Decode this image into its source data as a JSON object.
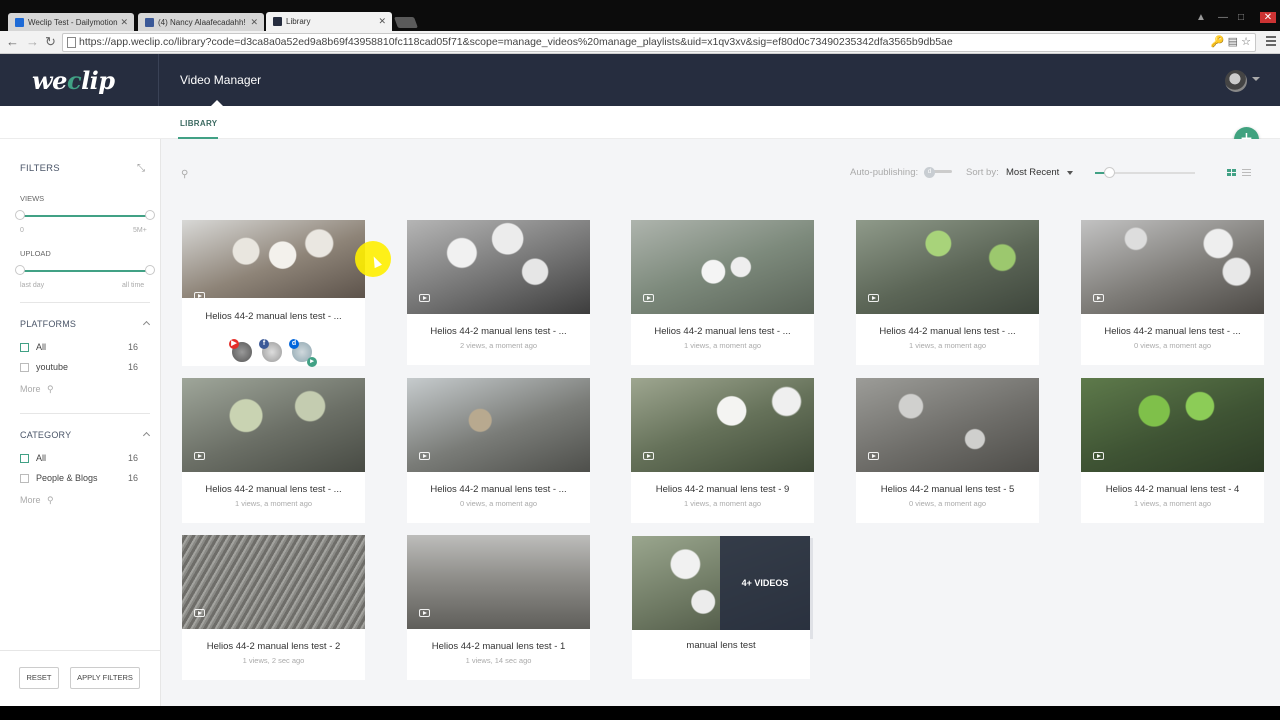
{
  "browser": {
    "tabs": [
      {
        "label": "Weclip Test - Dailymotion",
        "icon": "dailymotion-icon"
      },
      {
        "label": "(4) Nancy Alaafecadahh!",
        "icon": "facebook-icon"
      },
      {
        "label": "Library",
        "icon": "weclip-icon"
      }
    ],
    "url": "https://app.weclip.co/library?code=d3ca8a0a52ed9a8b69f43958810fc118cad05f71&scope=manage_videos%20manage_playlists&uid=x1qv3xv&sig=ef80d0c73490235342dfa3565b9db5ae"
  },
  "header": {
    "logo": {
      "pre": "we",
      "mid": "c",
      "post": "lip"
    },
    "title": "Video Manager"
  },
  "subnav": {
    "tab": "LIBRARY"
  },
  "sidebar": {
    "title": "FILTERS",
    "views_label": "VIEWS",
    "views_min": "0",
    "views_max": "5M+",
    "upload_label": "UPLOAD",
    "upload_min": "last day",
    "upload_max": "all time",
    "platforms_title": "PLATFORMS",
    "platforms": [
      {
        "label": "All",
        "count": "16"
      },
      {
        "label": "youtube",
        "count": "16"
      }
    ],
    "more": "More",
    "category_title": "CATEGORY",
    "categories": [
      {
        "label": "All",
        "count": "16"
      },
      {
        "label": "People & Blogs",
        "count": "16"
      }
    ],
    "reset": "RESET",
    "apply": "APPLY FILTERS"
  },
  "toolbar": {
    "autopub_label": "Auto-publishing:",
    "sort_label": "Sort by:",
    "sort_value": "Most Recent"
  },
  "colors": {
    "accent": "#41a185",
    "header_bg": "#262d3f"
  },
  "videos": [
    {
      "title": "Helios 44-2 manual lens test - ...",
      "meta": ""
    },
    {
      "title": "Helios 44-2 manual lens test - ...",
      "meta": "2 views, a moment ago"
    },
    {
      "title": "Helios 44-2 manual lens test - ...",
      "meta": "1 views, a moment ago"
    },
    {
      "title": "Helios 44-2 manual lens test - ...",
      "meta": "1 views, a moment ago"
    },
    {
      "title": "Helios 44-2 manual lens test - ...",
      "meta": "0 views, a moment ago"
    },
    {
      "title": "Helios 44-2 manual lens test - ...",
      "meta": "1 views, a moment ago"
    },
    {
      "title": "Helios 44-2 manual lens test - ...",
      "meta": "0 views, a moment ago"
    },
    {
      "title": "Helios 44-2 manual lens test - 9",
      "meta": "1 views, a moment ago"
    },
    {
      "title": "Helios 44-2 manual lens test - 5",
      "meta": "0 views, a moment ago"
    },
    {
      "title": "Helios 44-2 manual lens test - 4",
      "meta": "1 views, a moment ago"
    },
    {
      "title": "Helios 44-2 manual lens test - 2",
      "meta": "1 views, 2 sec ago"
    },
    {
      "title": "Helios 44-2 manual lens test - 1",
      "meta": "1 views, 14 sec ago"
    }
  ],
  "playlist": {
    "title": "manual lens test",
    "count": "4+ VIDEOS"
  }
}
